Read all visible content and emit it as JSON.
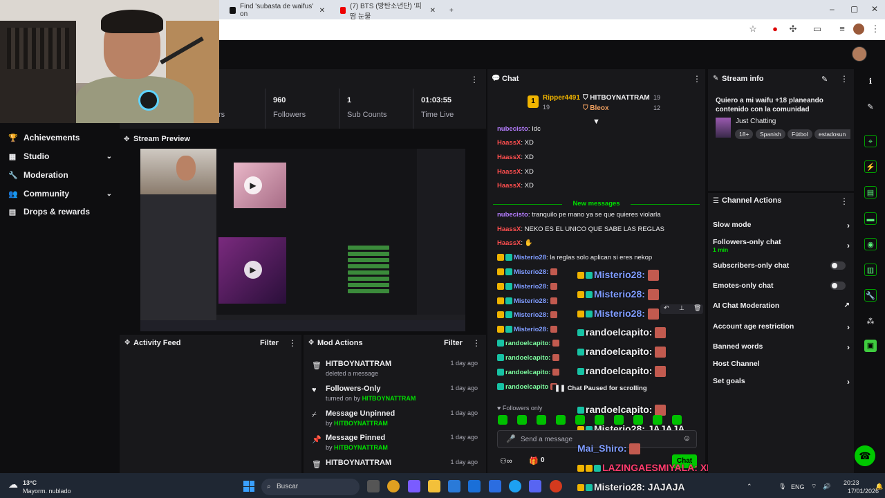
{
  "browser": {
    "tab1_title": "Find 'subasta de waifus' on",
    "tab2_title": "(7) BTS (방탄소년단) '피 땀 눈물",
    "new_tab": "+"
  },
  "nav": {
    "items": [
      {
        "label": "Achievements",
        "icon": "trophy-icon"
      },
      {
        "label": "Studio",
        "icon": "studio-icon",
        "chevron": "⌄"
      },
      {
        "label": "Moderation",
        "icon": "wrench-icon"
      },
      {
        "label": "Community",
        "icon": "community-icon",
        "chevron": "⌄"
      },
      {
        "label": "Drops & rewards",
        "icon": "drops-icon"
      }
    ]
  },
  "stats": {
    "partial_label": "rs",
    "followers_value": "960",
    "followers_label": "Followers",
    "subs_value": "1",
    "subs_label": "Sub Counts",
    "time_value": "01:03:55",
    "time_label": "Time Live"
  },
  "preview": {
    "title": "Stream Preview"
  },
  "activity": {
    "title": "Activity Feed",
    "filter": "Filter"
  },
  "mod_actions": {
    "title": "Mod Actions",
    "filter": "Filter",
    "items": [
      {
        "title": "HITBOYNATTRAM",
        "sub": "deleted a message",
        "by": "",
        "date": "1 day ago",
        "icon": "trash-icon"
      },
      {
        "title": "Followers-Only",
        "sub": "turned on by",
        "by": "HITBOYNATTRAM",
        "date": "1 day ago",
        "icon": "heart-icon"
      },
      {
        "title": "Message Unpinned",
        "sub": "by",
        "by": "HITBOYNATTRAM",
        "date": "1 day ago",
        "icon": "unpin-icon"
      },
      {
        "title": "Message Pinned",
        "sub": "by",
        "by": "HITBOYNATTRAM",
        "date": "1 day ago",
        "icon": "pin-icon"
      },
      {
        "title": "HITBOYNATTRAM",
        "sub": "",
        "by": "",
        "date": "1 day ago",
        "icon": "trash-icon"
      }
    ]
  },
  "chat": {
    "title": "Chat",
    "leaders": [
      {
        "rank": "1",
        "name": "Ripper4491",
        "count": "19"
      },
      {
        "name": "HITBOYNATTRAM",
        "count": "19"
      },
      {
        "name": "Bleox",
        "count": "12"
      }
    ],
    "messages_top": [
      {
        "user": "nubecisto",
        "text": ": Idc"
      },
      {
        "user": "HaassX",
        "text": ": XD"
      },
      {
        "user": "HaassX",
        "text": ": XD"
      },
      {
        "user": "HaassX",
        "text": ": XD"
      },
      {
        "user": "HaassX",
        "text": ": XD"
      }
    ],
    "new_messages": "New messages",
    "messages_new": [
      {
        "user": "nubecisto",
        "text": ": tranquilo pe mano ya se que quieres violarla"
      },
      {
        "user": "HaassX",
        "text": ": NEKO ES EL UNICO QUE SABE LAS REGLAS"
      },
      {
        "user": "HaassX",
        "text": ":"
      },
      {
        "user": "Misterio28",
        "text": ": la reglas solo aplican si eres nekop"
      }
    ],
    "repeat_users": [
      "Misterio28:",
      "Misterio28:",
      "Misterio28:",
      "Misterio28:",
      "Misterio28:",
      "randoelcapito:",
      "randoelcapito:",
      "randoelcapito:",
      "randoelcapito"
    ],
    "overlay": [
      "Misterio28:",
      "Misterio28:",
      "Misterio28:",
      "randoelcapito:",
      "randoelcapito:",
      "randoelcapito:",
      "randoelcapito:",
      "randoelcapito:"
    ],
    "overlay_misterio_jaja": "Misterio28: JAJAJA",
    "overlay_mai": "Mai_Shiro:",
    "overlay_lazinga": "LAZINGAESMIYALA: XDXDXD",
    "overlay_misterio_jaja2": "Misterio28: JAJAJA",
    "paused": "Chat Paused for scrolling",
    "followers_only": "Followers only",
    "input_placeholder": "Send a message",
    "send": "Chat",
    "points": "0"
  },
  "stream_info": {
    "title": "Stream info",
    "stream_title": "Quiero a mi waifu +18 planeando contenido con la comunidad",
    "category": "Just Chatting",
    "tags": [
      "18+",
      "Spanish",
      "Fútbol",
      "estadosun"
    ]
  },
  "channel_actions": {
    "title": "Channel Actions",
    "items": [
      {
        "label": "Slow mode",
        "control": "chevron"
      },
      {
        "label": "Followers-only chat",
        "sub": "1 min",
        "control": "chevron"
      },
      {
        "label": "Subscribers-only chat",
        "control": "toggle"
      },
      {
        "label": "Emotes-only chat",
        "control": "toggle"
      },
      {
        "label": "AI Chat Moderation",
        "control": "external"
      },
      {
        "label": "Account age restriction",
        "control": "chevron"
      },
      {
        "label": "Banned words",
        "control": "chevron"
      },
      {
        "label": "Host Channel",
        "control": "none"
      },
      {
        "label": "Set goals",
        "control": "chevron"
      }
    ]
  },
  "taskbar": {
    "weather_temp": "13°C",
    "weather_desc": "Mayorm. nublado",
    "search": "Buscar",
    "lang": "ENG",
    "time": "20:23",
    "date": "17/01/2026"
  },
  "colors": {
    "accent_green": "#00e000",
    "panel_bg": "#18181b",
    "page_bg": "#0e0e10"
  }
}
